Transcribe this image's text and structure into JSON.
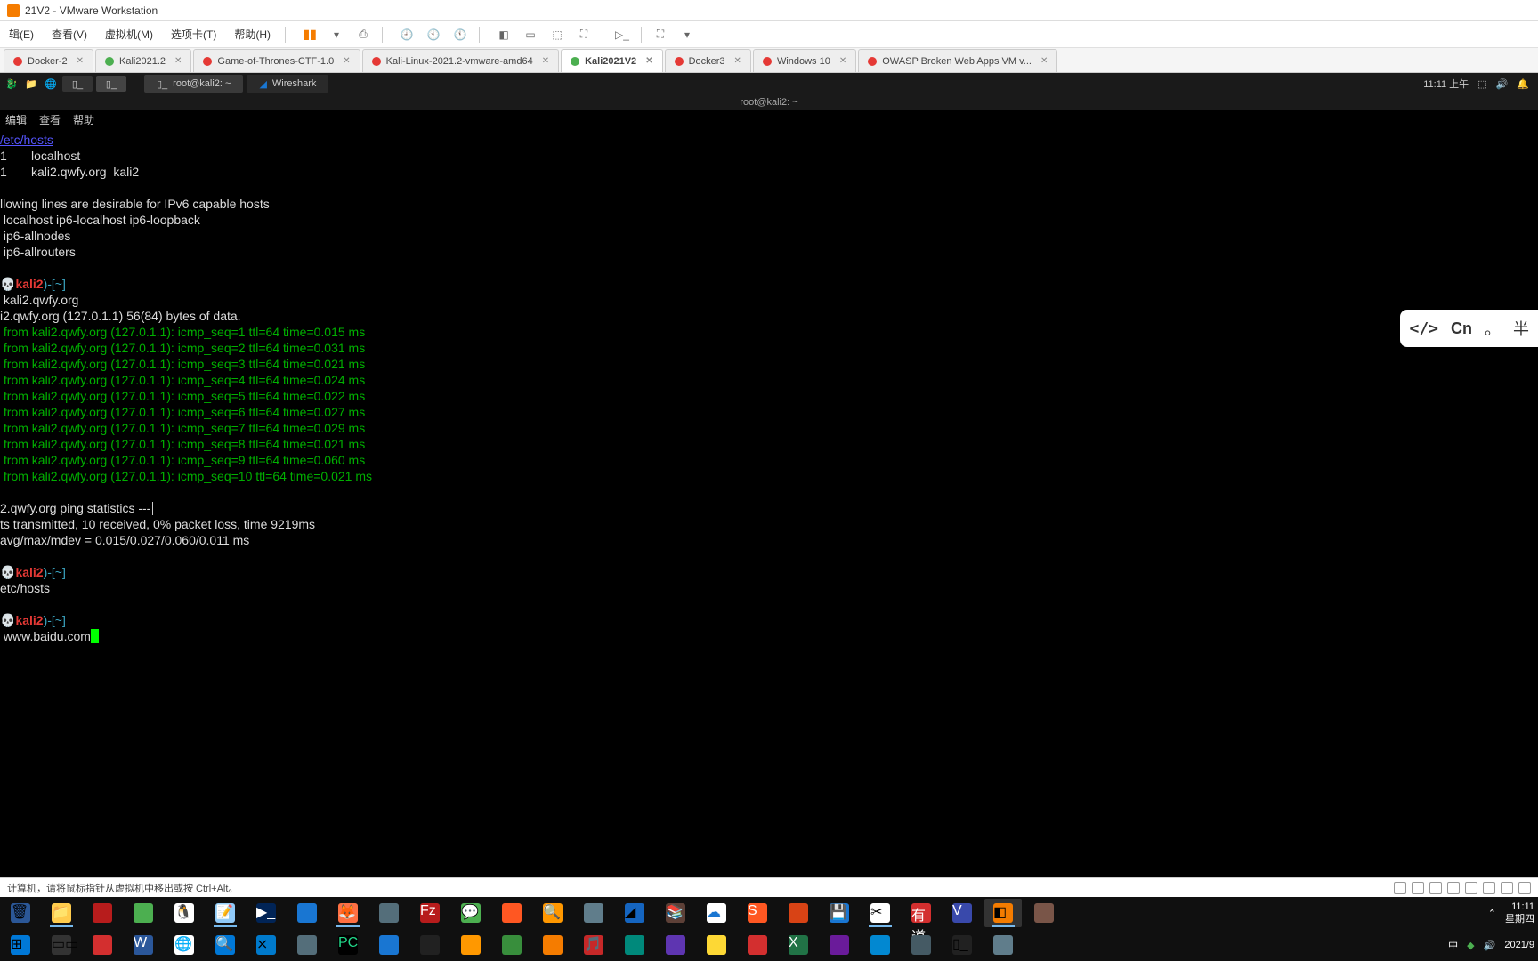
{
  "window": {
    "title": "21V2 - VMware Workstation"
  },
  "menu": {
    "edit": "辑(E)",
    "view": "查看(V)",
    "vm": "虚拟机(M)",
    "tabs": "选项卡(T)",
    "help": "帮助(H)"
  },
  "vm_tabs": {
    "t0": "Docker-2",
    "t1": "Kali2021.2",
    "t2": "Game-of-Thrones-CTF-1.0",
    "t3": "Kali-Linux-2021.2-vmware-amd64",
    "t4": "Kali2021V2",
    "t5": "Docker3",
    "t6": "Windows 10",
    "t7": "OWASP Broken Web Apps VM v..."
  },
  "kali_panel": {
    "task1": "root@kali2: ~",
    "task2": "Wireshark",
    "clock": "11:11 上午"
  },
  "terminal": {
    "title": "root@kali2: ~",
    "menu": {
      "m1": "编辑",
      "m2": "查看",
      "m3": "帮助"
    },
    "hosts_header": "/etc/hosts",
    "hosts_l1": "1       localhost",
    "hosts_l2": "1       kali2.qwfy.org  kali2",
    "hosts_l3": "llowing lines are desirable for IPv6 capable hosts",
    "hosts_l4": " localhost ip6-localhost ip6-loopback",
    "hosts_l5": " ip6-allnodes",
    "hosts_l6": " ip6-allrouters",
    "prompt_user": "kali2",
    "prompt_path": ")-[~]",
    "ping_target": " kali2.qwfy.org",
    "ping_head": "i2.qwfy.org (127.0.1.1) 56(84) bytes of data.",
    "ping1": " from kali2.qwfy.org (127.0.1.1): icmp_seq=1 ttl=64 time=0.015 ms",
    "ping2": " from kali2.qwfy.org (127.0.1.1): icmp_seq=2 ttl=64 time=0.031 ms",
    "ping3": " from kali2.qwfy.org (127.0.1.1): icmp_seq=3 ttl=64 time=0.021 ms",
    "ping4": " from kali2.qwfy.org (127.0.1.1): icmp_seq=4 ttl=64 time=0.024 ms",
    "ping5": " from kali2.qwfy.org (127.0.1.1): icmp_seq=5 ttl=64 time=0.022 ms",
    "ping6": " from kali2.qwfy.org (127.0.1.1): icmp_seq=6 ttl=64 time=0.027 ms",
    "ping7": " from kali2.qwfy.org (127.0.1.1): icmp_seq=7 ttl=64 time=0.029 ms",
    "ping8": " from kali2.qwfy.org (127.0.1.1): icmp_seq=8 ttl=64 time=0.021 ms",
    "ping9": " from kali2.qwfy.org (127.0.1.1): icmp_seq=9 ttl=64 time=0.060 ms",
    "ping10": " from kali2.qwfy.org (127.0.1.1): icmp_seq=10 ttl=64 time=0.021 ms",
    "stats1": "2.qwfy.org ping statistics ---",
    "stats2": "ts transmitted, 10 received, 0% packet loss, time 9219ms",
    "stats3": "avg/max/mdev = 0.015/0.027/0.060/0.011 ms",
    "cmd_cat": "etc/hosts",
    "cmd_ping2": " www.baidu.com"
  },
  "ime": {
    "code": "</>",
    "lang": "Cn",
    "punct": "。",
    "half": "半"
  },
  "vm_status": {
    "msg": "计算机，请将鼠标指针从虚拟机中移出或按 Ctrl+Alt。"
  },
  "win_tb": {
    "clock1": "11:11",
    "clock2": "星期四",
    "date": "2021/9",
    "ime": "中",
    "tray_up": "⌃"
  }
}
